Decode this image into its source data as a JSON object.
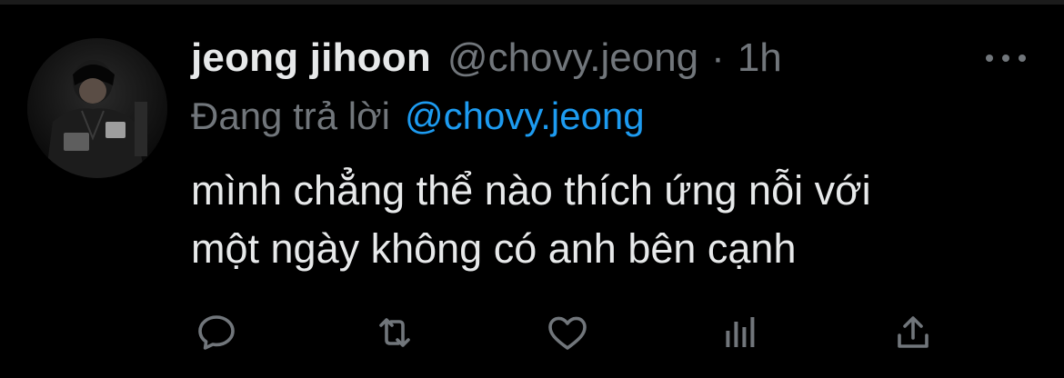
{
  "tweet": {
    "display_name": "jeong jihoon",
    "handle": "@chovy.jeong",
    "separator": "·",
    "time": "1h",
    "reply_prefix": "Đang trả lời",
    "reply_to": "@chovy.jeong",
    "text_lines": [
      "mình chẳng thể nào thích ứng nỗi với",
      "một ngày không có anh bên cạnh"
    ]
  },
  "icons": {
    "more": "more-horizontal-icon",
    "reply": "reply-bubble-icon",
    "retweet": "retweet-icon",
    "like": "heart-icon",
    "analytics": "analytics-bars-icon",
    "share": "share-upload-icon"
  },
  "colors": {
    "background": "#000000",
    "primary_text": "#e7e9ea",
    "secondary_text": "#71767b",
    "link": "#1d9bf0"
  }
}
